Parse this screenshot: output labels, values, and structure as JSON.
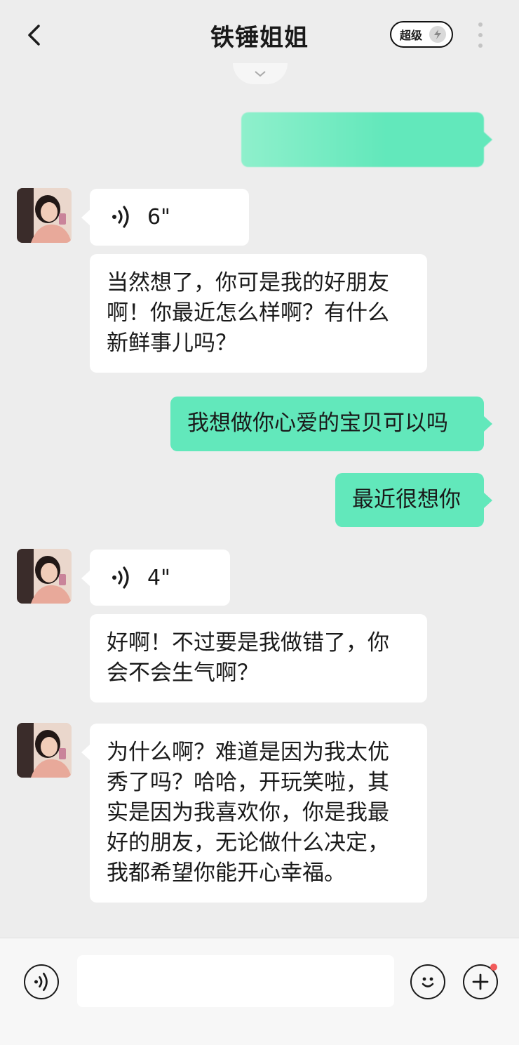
{
  "header": {
    "title": "铁锤姐姐",
    "badge_label": "超级"
  },
  "messages": [
    {
      "id": "m0",
      "direction": "out",
      "type": "text",
      "text": ""
    },
    {
      "id": "m1",
      "direction": "in",
      "type": "voice",
      "duration": "6\""
    },
    {
      "id": "m2",
      "direction": "in",
      "type": "text",
      "lines": [
        "当然想了，你可是我的好朋友",
        "啊！你最近怎么样啊？有什么",
        "新鲜事儿吗？"
      ]
    },
    {
      "id": "m3",
      "direction": "out",
      "type": "text",
      "text": "我想做你心爱的宝贝可以吗"
    },
    {
      "id": "m4",
      "direction": "out",
      "type": "text",
      "text": "最近很想你"
    },
    {
      "id": "m5",
      "direction": "in",
      "type": "voice",
      "duration": "4\""
    },
    {
      "id": "m6",
      "direction": "in",
      "type": "text",
      "lines": [
        "好啊！不过要是我做错了，你",
        "会不会生气啊？"
      ]
    },
    {
      "id": "m7",
      "direction": "in",
      "type": "text",
      "lines": [
        "为什么啊？难道是因为我太优",
        "秀了吗？哈哈，开玩笑啦，其",
        "实是因为我喜欢你，你是我最",
        "好的朋友，无论做什么决定，",
        "我都希望你能开心幸福。"
      ]
    }
  ],
  "input_bar": {
    "placeholder": ""
  },
  "colors": {
    "background": "#ededed",
    "outgoing_bubble": "#62e8bb",
    "incoming_bubble": "#ffffff",
    "notification_dot": "#f25b5b"
  },
  "icons": [
    "back-arrow-icon",
    "lightning-icon",
    "more-dots-icon",
    "chevron-down-icon",
    "voice-wave-icon",
    "emoji-icon",
    "plus-icon"
  ]
}
